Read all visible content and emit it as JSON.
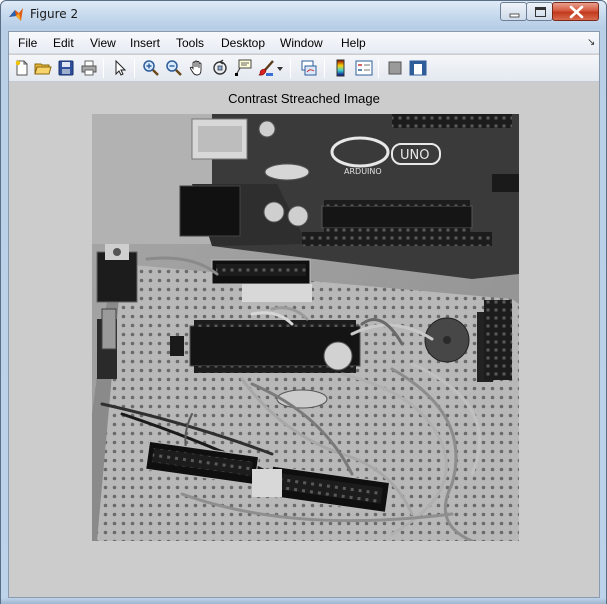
{
  "window": {
    "title": "Figure 2"
  },
  "menu": {
    "items": [
      "File",
      "Edit",
      "View",
      "Insert",
      "Tools",
      "Desktop",
      "Window",
      "Help"
    ],
    "dock_glyph": "↘"
  },
  "toolbar": {
    "icons": [
      "new-figure-icon",
      "open-file-icon",
      "save-figure-icon",
      "print-figure-icon",
      "edit-plot-arrow-icon",
      "zoom-in-icon",
      "zoom-out-icon",
      "pan-hand-icon",
      "rotate-3d-icon",
      "data-cursor-icon",
      "brush-icon",
      "link-plot-icon",
      "insert-colorbar-icon",
      "insert-legend-icon",
      "hide-plot-tools-icon",
      "show-plot-tools-icon"
    ]
  },
  "axes": {
    "title": "Contrast Streached Image"
  },
  "image": {
    "board_markings": [
      "ARDUINO",
      "UNO"
    ]
  },
  "colors": {
    "figure_background": "#cccccc",
    "titlebar": "#c7daee",
    "close_button": "#c3391c"
  }
}
